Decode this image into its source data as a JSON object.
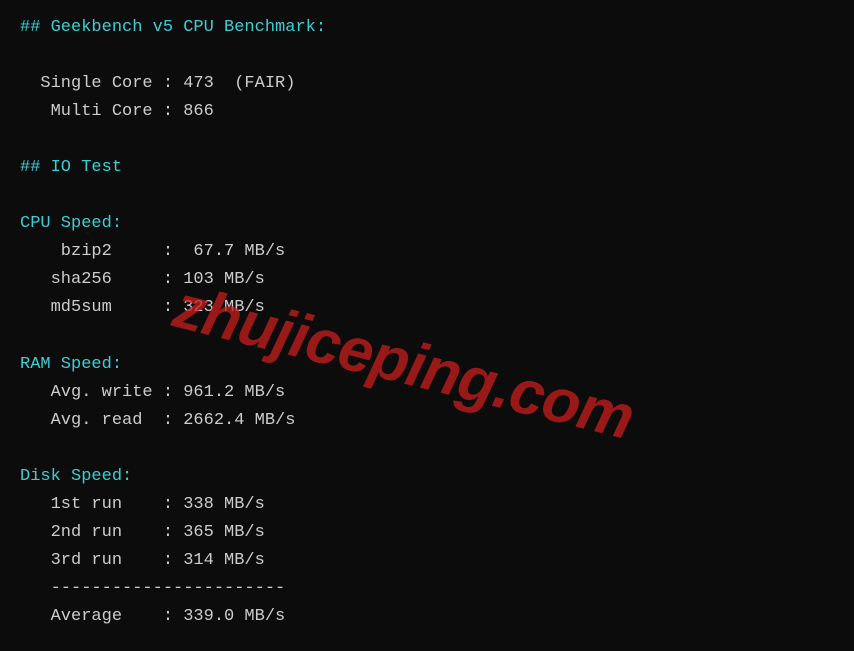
{
  "header_geekbench": "## Geekbench v5 CPU Benchmark:",
  "geekbench": {
    "single_line": "  Single Core : 473  (FAIR)",
    "multi_line": "   Multi Core : 866"
  },
  "header_io": "## IO Test",
  "cpu_speed": {
    "header": "CPU Speed:",
    "bzip2": "    bzip2     :  67.7 MB/s",
    "sha256": "   sha256     : 103 MB/s",
    "md5sum": "   md5sum     : 323 MB/s"
  },
  "ram_speed": {
    "header": "RAM Speed:",
    "write": "   Avg. write : 961.2 MB/s",
    "read": "   Avg. read  : 2662.4 MB/s"
  },
  "disk_speed": {
    "header": "Disk Speed:",
    "run1": "   1st run    : 338 MB/s",
    "run2": "   2nd run    : 365 MB/s",
    "run3": "   3rd run    : 314 MB/s",
    "divider": "   -----------------------",
    "average": "   Average    : 339.0 MB/s"
  },
  "watermark": "zhujiceping.com"
}
